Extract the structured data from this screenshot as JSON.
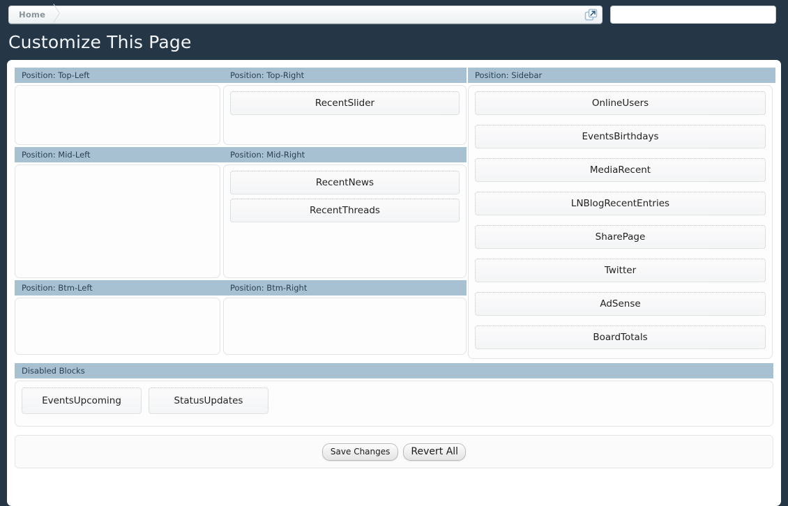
{
  "topbar": {
    "breadcrumb": [
      {
        "label": "Home"
      }
    ],
    "popout_icon": "external-link-icon",
    "search_value": "",
    "search_placeholder": ""
  },
  "page": {
    "title": "Customize This Page"
  },
  "zones": [
    {
      "id": "top-left",
      "header": "Position: Top-Left",
      "blocks": []
    },
    {
      "id": "top-right",
      "header": "Position: Top-Right",
      "blocks": [
        "RecentSlider"
      ]
    },
    {
      "id": "mid-left",
      "header": "Position: Mid-Left",
      "blocks": []
    },
    {
      "id": "mid-right",
      "header": "Position: Mid-Right",
      "blocks": [
        "RecentNews",
        "RecentThreads"
      ]
    },
    {
      "id": "btm-left",
      "header": "Position: Btm-Left",
      "blocks": []
    },
    {
      "id": "btm-right",
      "header": "Position: Btm-Right",
      "blocks": []
    },
    {
      "id": "sidebar",
      "header": "Position: Sidebar",
      "blocks": [
        "OnlineUsers",
        "EventsBirthdays",
        "MediaRecent",
        "LNBlogRecentEntries",
        "SharePage",
        "Twitter",
        "AdSense",
        "BoardTotals"
      ]
    }
  ],
  "disabled": {
    "header": "Disabled Blocks",
    "blocks": [
      "EventsUpcoming",
      "StatusUpdates"
    ]
  },
  "actions": {
    "save_label": "Save Changes",
    "revert_label": "Revert All"
  },
  "colors": {
    "page_background": "#253746",
    "panel_background": "#ffffff",
    "zone_header": "#a7c1d2",
    "zone_header_text": "#2b3f50",
    "block_border": "#c6c6c6",
    "title_text": "#f2f5f7"
  }
}
